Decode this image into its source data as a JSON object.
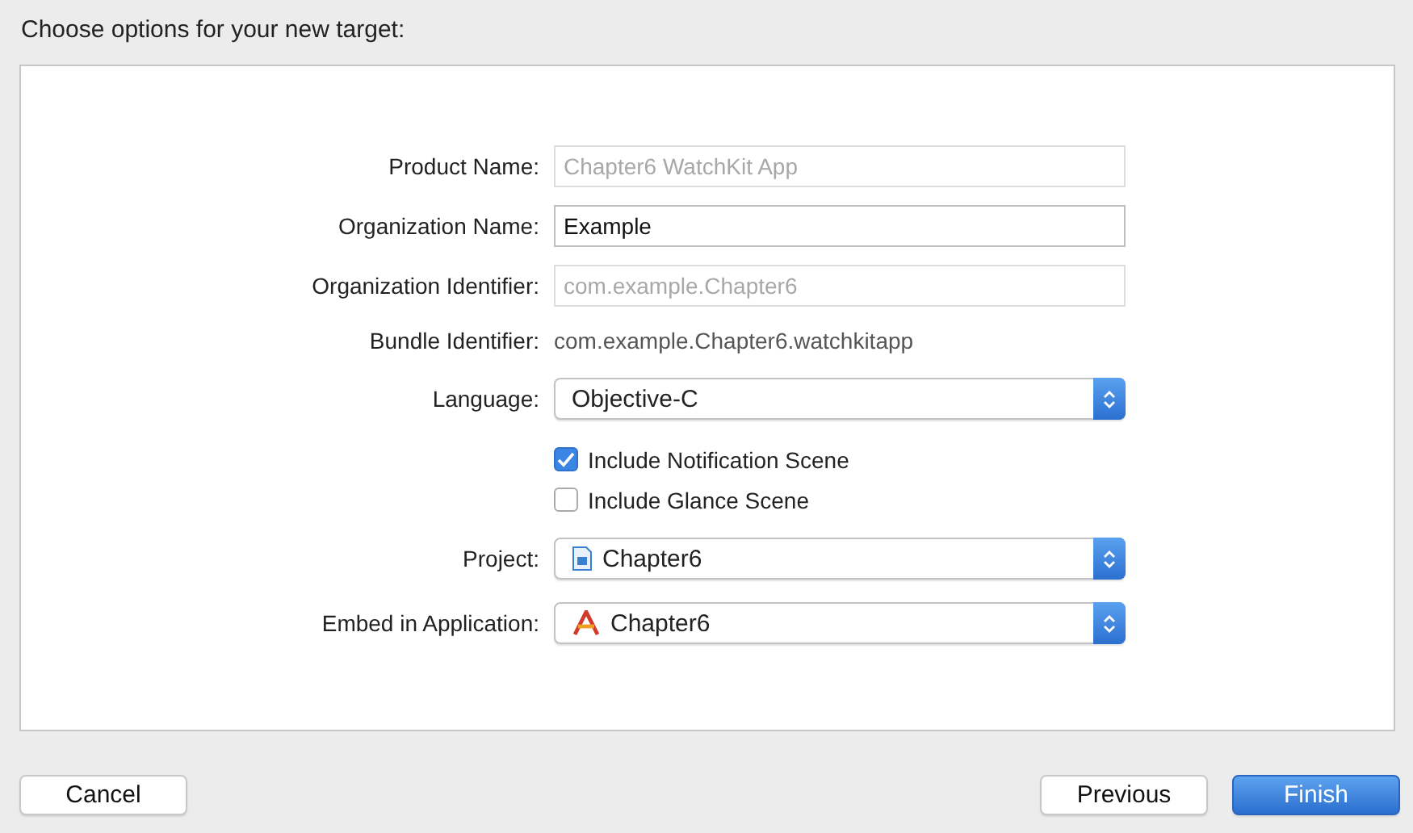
{
  "title": "Choose options for your new target:",
  "rows": [
    {
      "kind": "text",
      "label": "Product Name:",
      "value": "Chapter6 WatchKit App",
      "disabled": true
    },
    {
      "kind": "text",
      "label": "Organization Name:",
      "value": "Example",
      "disabled": false
    },
    {
      "kind": "text",
      "label": "Organization Identifier:",
      "value": "com.example.Chapter6",
      "disabled": true
    },
    {
      "kind": "static",
      "label": "Bundle Identifier:",
      "value": "com.example.Chapter6.watchkitapp"
    },
    {
      "kind": "popup",
      "label": "Language:",
      "value": "Objective-C"
    },
    {
      "kind": "checkbox",
      "label": "Include Notification Scene",
      "checked": true
    },
    {
      "kind": "checkbox",
      "label": "Include Glance Scene",
      "checked": false
    },
    {
      "kind": "docpopup",
      "label": "Project:",
      "value": "Chapter6"
    },
    {
      "kind": "apppopup",
      "label": "Embed in Application:",
      "value": "Chapter6"
    }
  ],
  "buttons": [
    {
      "label": "Cancel",
      "default": false
    },
    {
      "label": "Previous",
      "default": false
    },
    {
      "label": "Finish",
      "default": true
    }
  ]
}
